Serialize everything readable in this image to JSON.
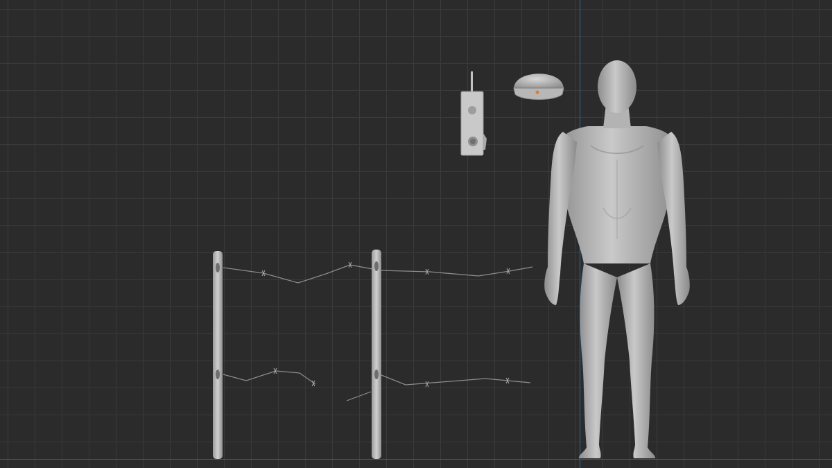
{
  "viewport": {
    "background": "#2b2b2b",
    "grid_color": "#3a3a3a",
    "axis_y_color": "#2e6aa6",
    "axis_x_color": "#8a3a44",
    "mesh_color": "#b7b7b7"
  },
  "scene_objects": [
    {
      "name": "walkie-talkie",
      "icon": "radio-icon"
    },
    {
      "name": "dome-helmet",
      "icon": "helmet-icon"
    },
    {
      "name": "human-figure",
      "icon": "person-icon"
    },
    {
      "name": "fence-post-left",
      "icon": "post-icon"
    },
    {
      "name": "fence-post-right",
      "icon": "post-icon"
    },
    {
      "name": "barbed-wire-upper",
      "icon": "wire-icon"
    },
    {
      "name": "barbed-wire-lower",
      "icon": "wire-icon"
    }
  ]
}
